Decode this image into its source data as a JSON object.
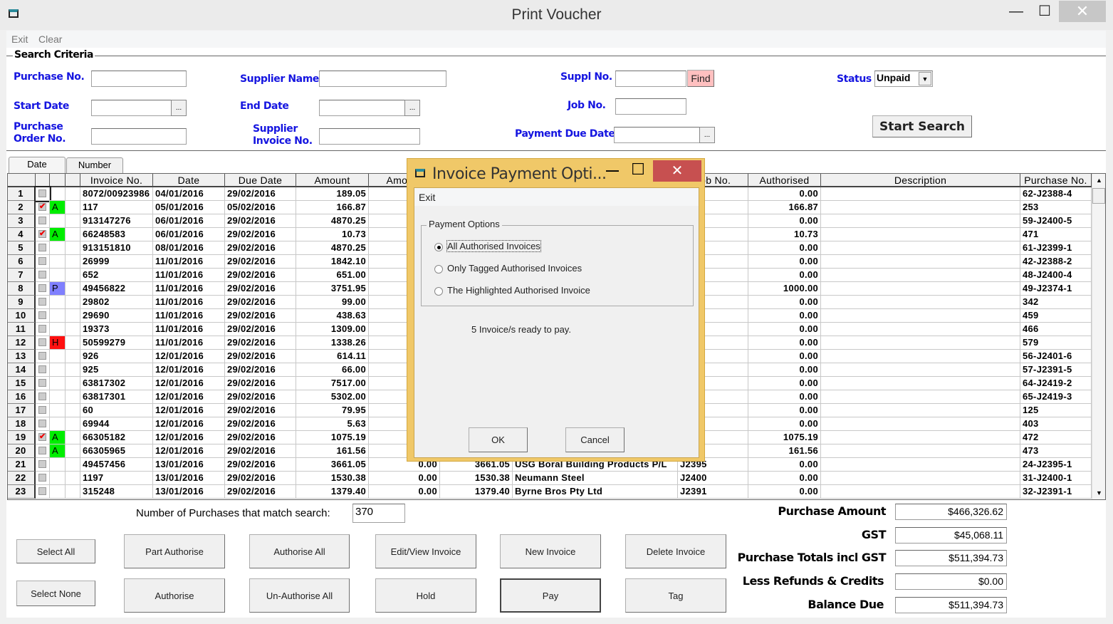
{
  "window": {
    "title": "Print Voucher",
    "minimize": "—",
    "maximize": "☐",
    "close": "✕"
  },
  "menu": {
    "exit": "Exit",
    "clear": "Clear"
  },
  "search": {
    "group_label": "Search Criteria",
    "purchase_no": "Purchase No.",
    "supplier_name": "Supplier Name",
    "suppl_no": "Suppl No.",
    "find": "Find",
    "status_label": "Status",
    "status_value": "Unpaid",
    "start_date": "Start Date",
    "end_date": "End Date",
    "job_no": "Job No.",
    "po_no_1": "Purchase",
    "po_no_2": "Order No.",
    "sinv_1": "Supplier",
    "sinv_2": "Invoice No.",
    "payment_due": "Payment Due Date",
    "start_search": "Start Search",
    "dots": "..."
  },
  "tabs": [
    "Date",
    "Number"
  ],
  "grid": {
    "headers": [
      "",
      "",
      "",
      "",
      "Invoice No.",
      "Date",
      "Due Date",
      "Amount",
      "Amount",
      "",
      "",
      "Job No.",
      "Authorised",
      "Description",
      "Purchase No."
    ],
    "rows": [
      {
        "n": "1",
        "tag": false,
        "st": "",
        "inv": "8072/00923986",
        "date": "04/01/2016",
        "due": "29/02/2016",
        "amt": "189.05",
        "a2": "",
        "a3": "",
        "sup": "",
        "job": "",
        "auth": "0.00",
        "desc": "",
        "po": "62-J2388-4"
      },
      {
        "n": "2",
        "tag": true,
        "st": "A",
        "inv": "117",
        "date": "05/01/2016",
        "due": "05/02/2016",
        "amt": "166.87",
        "a2": "",
        "a3": "",
        "sup": "",
        "job": "",
        "auth": "166.87",
        "desc": "",
        "po": "253"
      },
      {
        "n": "3",
        "tag": false,
        "st": "",
        "inv": "913147276",
        "date": "06/01/2016",
        "due": "29/02/2016",
        "amt": "4870.25",
        "a2": "",
        "a3": "",
        "sup": "",
        "job": "",
        "auth": "0.00",
        "desc": "",
        "po": "59-J2400-5"
      },
      {
        "n": "4",
        "tag": true,
        "st": "A",
        "inv": "66248583",
        "date": "06/01/2016",
        "due": "29/02/2016",
        "amt": "10.73",
        "a2": "",
        "a3": "",
        "sup": "",
        "job": "",
        "auth": "10.73",
        "desc": "",
        "po": "471"
      },
      {
        "n": "5",
        "tag": false,
        "st": "",
        "inv": "913151810",
        "date": "08/01/2016",
        "due": "29/02/2016",
        "amt": "4870.25",
        "a2": "",
        "a3": "",
        "sup": "",
        "job": "",
        "auth": "0.00",
        "desc": "",
        "po": "61-J2399-1"
      },
      {
        "n": "6",
        "tag": false,
        "st": "",
        "inv": "26999",
        "date": "11/01/2016",
        "due": "29/02/2016",
        "amt": "1842.10",
        "a2": "",
        "a3": "",
        "sup": "",
        "job": "",
        "auth": "0.00",
        "desc": "",
        "po": "42-J2388-2"
      },
      {
        "n": "7",
        "tag": false,
        "st": "",
        "inv": "652",
        "date": "11/01/2016",
        "due": "29/02/2016",
        "amt": "651.00",
        "a2": "",
        "a3": "",
        "sup": "",
        "job": "",
        "auth": "0.00",
        "desc": "",
        "po": "48-J2400-4"
      },
      {
        "n": "8",
        "tag": false,
        "st": "P",
        "inv": "49456822",
        "date": "11/01/2016",
        "due": "29/02/2016",
        "amt": "3751.95",
        "a2": "",
        "a3": "",
        "sup": "",
        "job": "",
        "auth": "1000.00",
        "desc": "",
        "po": "49-J2374-1"
      },
      {
        "n": "9",
        "tag": false,
        "st": "",
        "inv": "29802",
        "date": "11/01/2016",
        "due": "29/02/2016",
        "amt": "99.00",
        "a2": "",
        "a3": "",
        "sup": "",
        "job": "",
        "auth": "0.00",
        "desc": "",
        "po": "342"
      },
      {
        "n": "10",
        "tag": false,
        "st": "",
        "inv": "29690",
        "date": "11/01/2016",
        "due": "29/02/2016",
        "amt": "438.63",
        "a2": "",
        "a3": "",
        "sup": "",
        "job": "",
        "auth": "0.00",
        "desc": "",
        "po": "459"
      },
      {
        "n": "11",
        "tag": false,
        "st": "",
        "inv": "19373",
        "date": "11/01/2016",
        "due": "29/02/2016",
        "amt": "1309.00",
        "a2": "",
        "a3": "",
        "sup": "",
        "job": "",
        "auth": "0.00",
        "desc": "",
        "po": "466"
      },
      {
        "n": "12",
        "tag": false,
        "st": "H",
        "inv": "50599279",
        "date": "11/01/2016",
        "due": "29/02/2016",
        "amt": "1338.26",
        "a2": "",
        "a3": "",
        "sup": "",
        "job": "",
        "auth": "0.00",
        "desc": "",
        "po": "579"
      },
      {
        "n": "13",
        "tag": false,
        "st": "",
        "inv": "926",
        "date": "12/01/2016",
        "due": "29/02/2016",
        "amt": "614.11",
        "a2": "",
        "a3": "",
        "sup": "",
        "job": "",
        "auth": "0.00",
        "desc": "",
        "po": "56-J2401-6"
      },
      {
        "n": "14",
        "tag": false,
        "st": "",
        "inv": "925",
        "date": "12/01/2016",
        "due": "29/02/2016",
        "amt": "66.00",
        "a2": "",
        "a3": "",
        "sup": "",
        "job": "",
        "auth": "0.00",
        "desc": "",
        "po": "57-J2391-5"
      },
      {
        "n": "15",
        "tag": false,
        "st": "",
        "inv": "63817302",
        "date": "12/01/2016",
        "due": "29/02/2016",
        "amt": "7517.00",
        "a2": "",
        "a3": "",
        "sup": "",
        "job": "",
        "auth": "0.00",
        "desc": "",
        "po": "64-J2419-2"
      },
      {
        "n": "16",
        "tag": false,
        "st": "",
        "inv": "63817301",
        "date": "12/01/2016",
        "due": "29/02/2016",
        "amt": "5302.00",
        "a2": "",
        "a3": "",
        "sup": "",
        "job": "",
        "auth": "0.00",
        "desc": "",
        "po": "65-J2419-3"
      },
      {
        "n": "17",
        "tag": false,
        "st": "",
        "inv": "60",
        "date": "12/01/2016",
        "due": "29/02/2016",
        "amt": "79.95",
        "a2": "",
        "a3": "",
        "sup": "",
        "job": "",
        "auth": "0.00",
        "desc": "",
        "po": "125"
      },
      {
        "n": "18",
        "tag": false,
        "st": "",
        "inv": "69944",
        "date": "12/01/2016",
        "due": "29/02/2016",
        "amt": "5.63",
        "a2": "",
        "a3": "",
        "sup": "",
        "job": "",
        "auth": "0.00",
        "desc": "",
        "po": "403"
      },
      {
        "n": "19",
        "tag": true,
        "st": "A",
        "inv": "66305182",
        "date": "12/01/2016",
        "due": "29/02/2016",
        "amt": "1075.19",
        "a2": "",
        "a3": "",
        "sup": "",
        "job": "",
        "auth": "1075.19",
        "desc": "",
        "po": "472"
      },
      {
        "n": "20",
        "tag": false,
        "st": "A",
        "inv": "66305965",
        "date": "12/01/2016",
        "due": "29/02/2016",
        "amt": "161.56",
        "a2": "",
        "a3": "",
        "sup": "",
        "job": "",
        "auth": "161.56",
        "desc": "",
        "po": "473"
      },
      {
        "n": "21",
        "tag": false,
        "st": "",
        "inv": "49457456",
        "date": "13/01/2016",
        "due": "29/02/2016",
        "amt": "3661.05",
        "a2": "0.00",
        "a3": "3661.05",
        "sup": "USG Boral Building Products P/L",
        "job": "J2395",
        "auth": "0.00",
        "desc": "",
        "po": "24-J2395-1"
      },
      {
        "n": "22",
        "tag": false,
        "st": "",
        "inv": "1197",
        "date": "13/01/2016",
        "due": "29/02/2016",
        "amt": "1530.38",
        "a2": "0.00",
        "a3": "1530.38",
        "sup": "Neumann Steel",
        "job": "J2400",
        "auth": "0.00",
        "desc": "",
        "po": "31-J2400-1"
      },
      {
        "n": "23",
        "tag": false,
        "st": "",
        "inv": "315248",
        "date": "13/01/2016",
        "due": "29/02/2016",
        "amt": "1379.40",
        "a2": "0.00",
        "a3": "1379.40",
        "sup": "Byrne Bros Pty Ltd",
        "job": "J2391",
        "auth": "0.00",
        "desc": "",
        "po": "32-J2391-1"
      }
    ]
  },
  "status_colors": {
    "A": "#00ee00",
    "P": "#8080ff",
    "H": "#ff1010"
  },
  "footer": {
    "match_label": "Number of Purchases that match search:",
    "match_count": "370"
  },
  "buttons": {
    "select_all": "Select All",
    "part_authorise": "Part Authorise",
    "authorise_all": "Authorise All",
    "edit_view": "Edit/View Invoice",
    "new_invoice": "New Invoice",
    "delete_invoice": "Delete Invoice",
    "select_none": "Select None",
    "authorise": "Authorise",
    "unauthorise_all": "Un-Authorise All",
    "hold": "Hold",
    "pay": "Pay",
    "tag": "Tag"
  },
  "totals": [
    {
      "label": "Purchase Amount",
      "value": "$466,326.62"
    },
    {
      "label": "GST",
      "value": "$45,068.11"
    },
    {
      "label": "Purchase Totals incl GST",
      "value": "$511,394.73"
    },
    {
      "label": "Less Refunds & Credits",
      "value": "$0.00"
    },
    {
      "label": "Balance Due",
      "value": "$511,394.73"
    }
  ],
  "dialog": {
    "title": "Invoice Payment Opti...",
    "menu_exit": "Exit",
    "group": "Payment Options",
    "options": [
      {
        "label": "All Authorised Invoices",
        "selected": true
      },
      {
        "label": "Only Tagged Authorised Invoices",
        "selected": false
      },
      {
        "label": "The Highlighted Authorised Invoice",
        "selected": false
      }
    ],
    "message": "5 Invoice/s ready to pay.",
    "ok": "OK",
    "cancel": "Cancel",
    "close": "✕",
    "maximize": "☐",
    "minimize": "—"
  }
}
